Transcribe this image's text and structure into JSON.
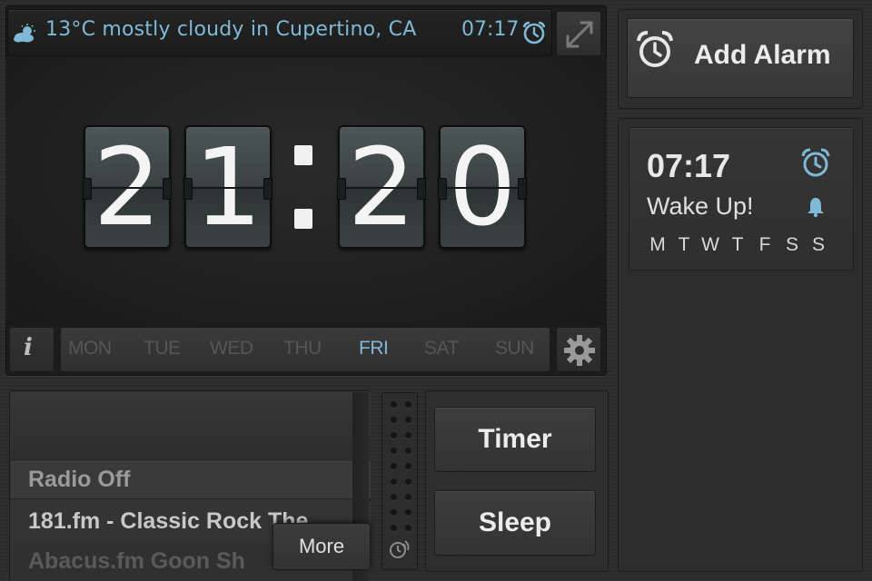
{
  "header": {
    "weather_text": "13°C mostly cloudy in Cupertino, CA",
    "next_alarm_time": "07:17"
  },
  "clock": {
    "digits": [
      "2",
      "1",
      "2",
      "0"
    ],
    "time": "21:20"
  },
  "weekdays": {
    "items": [
      "MON",
      "TUE",
      "WED",
      "THU",
      "FRI",
      "SAT",
      "SUN"
    ],
    "active": "FRI",
    "info_label": "i"
  },
  "radio": {
    "status_label": "Radio Off",
    "station_label": "181.fm - Classic Rock The",
    "station_label_2": "Abacus.fm Goon Sh",
    "more_label": "More"
  },
  "actions": {
    "timer_label": "Timer",
    "sleep_label": "Sleep",
    "add_alarm_label": "Add Alarm"
  },
  "alarm": {
    "time": "07:17",
    "label": "Wake Up!",
    "repeat_days": [
      "M",
      "T",
      "W",
      "T",
      "F",
      "S",
      "S"
    ]
  },
  "colors": {
    "accent": "#7fb9d6",
    "background": "#2d2d2d",
    "flip_card": "#3a4242",
    "inactive_day": "#565656"
  },
  "icons": {
    "weather": "partly-cloudy-icon",
    "alarm": "alarm-clock-icon",
    "fullscreen": "expand-icon",
    "settings": "gear-icon",
    "info": "info-icon",
    "bell": "bell-icon",
    "snooze": "snooze-icon"
  }
}
